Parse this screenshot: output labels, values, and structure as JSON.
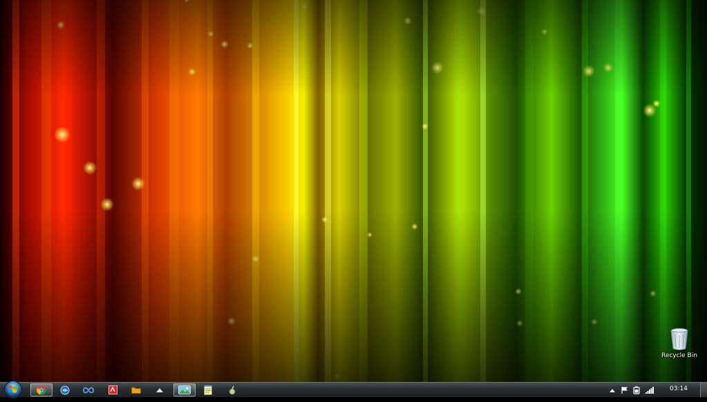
{
  "desktop": {
    "icons": [
      {
        "label": "Recycle Bin",
        "icon": "recycle-bin-icon"
      }
    ]
  },
  "taskbar": {
    "start": {
      "icon": "windows-start-orb-icon"
    },
    "pinned": [
      {
        "icon": "chrome-icon",
        "active": true
      },
      {
        "icon": "browser-globe-icon",
        "active": false
      },
      {
        "icon": "infinity-app-icon",
        "active": false
      },
      {
        "icon": "red-app-icon",
        "active": false
      },
      {
        "icon": "folder-app-icon",
        "active": false
      },
      {
        "icon": "media-app-icon",
        "active": false
      },
      {
        "icon": "photo-viewer-icon",
        "active": true
      },
      {
        "icon": "notepad-icon",
        "active": false
      },
      {
        "icon": "tool-app-icon",
        "active": false
      }
    ],
    "tray": {
      "icons": [
        "show-hidden-icons-arrow-icon",
        "action-center-flag-icon",
        "power-battery-icon",
        "network-signal-icon"
      ]
    },
    "clock": {
      "time": "03:14"
    }
  },
  "colors": {
    "taskbar_top": "#4a4f52",
    "taskbar_bottom": "#1c1f21",
    "label_text": "#ffffff"
  }
}
